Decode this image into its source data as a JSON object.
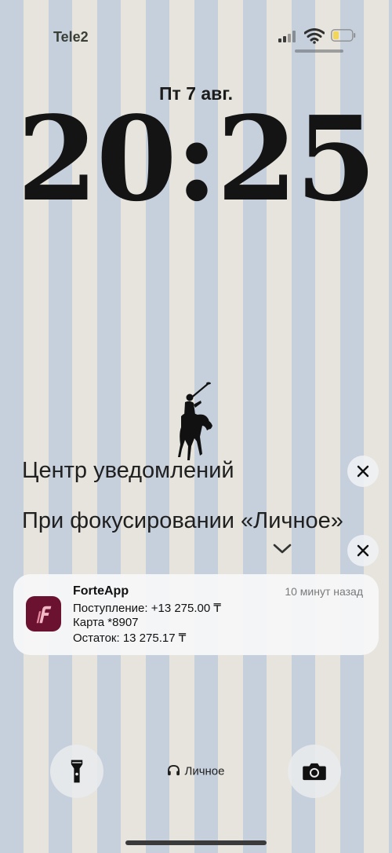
{
  "status_bar": {
    "carrier": "Tele2",
    "signal_icon": "cellular-signal-icon",
    "wifi_icon": "wifi-icon",
    "battery_icon": "battery-low-icon",
    "battery_color": "#f2d65a"
  },
  "lock_screen": {
    "date": "Пт 7 авг.",
    "time": "20:25",
    "wallpaper_logo": "polo-player-logo"
  },
  "notification_center": {
    "title": "Центр уведомлений",
    "focus_section_title": "При фокусировании «Личное»",
    "close_icon": "close-icon",
    "expand_icon": "chevron-down-icon"
  },
  "notification": {
    "app_name": "ForteApp",
    "app_icon": "forteapp-icon",
    "app_icon_color": "#6a1230",
    "time_ago": "10 минут назад",
    "lines": [
      "Поступление: +13 275.00 ₸",
      "Карта *8907",
      "Остаток: 13 275.17 ₸"
    ]
  },
  "bottom_bar": {
    "flashlight_icon": "flashlight-icon",
    "focus_label": "Личное",
    "focus_icon": "headphones-icon",
    "camera_icon": "camera-icon"
  }
}
